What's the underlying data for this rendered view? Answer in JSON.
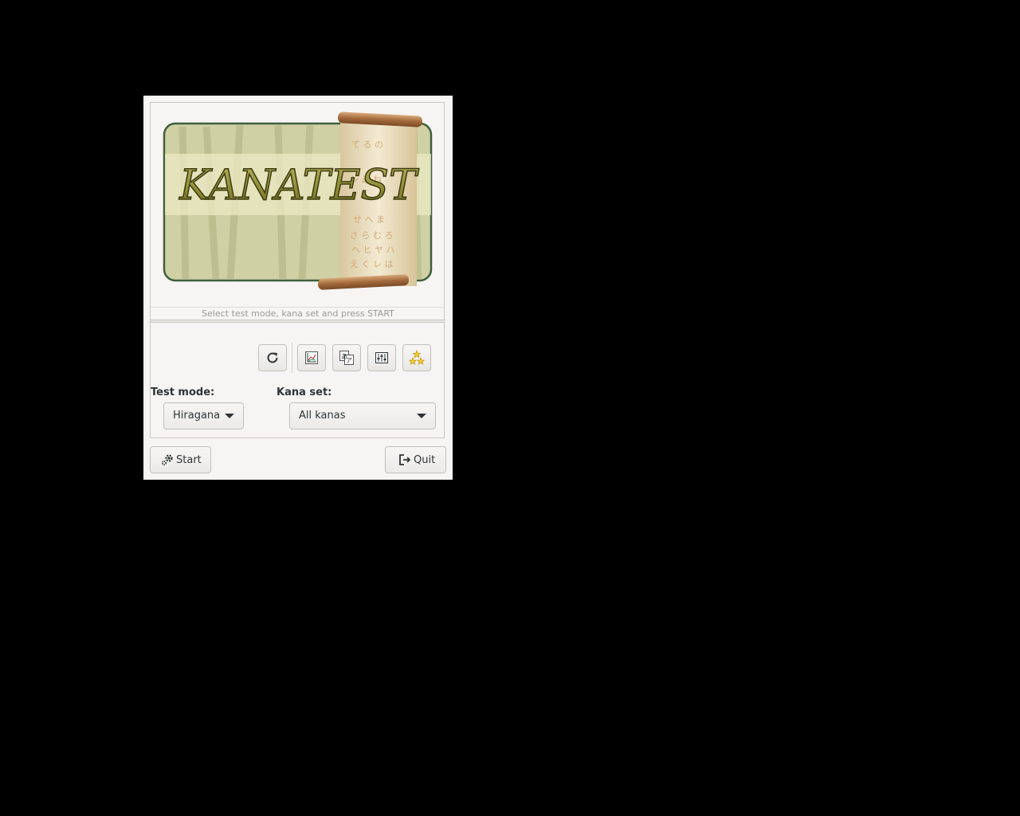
{
  "app": {
    "logo_text": "KANATEST"
  },
  "status_text": "Select test mode, kana set and press START",
  "toolbar": {
    "buttons": [
      {
        "icon": "refresh-icon"
      },
      {
        "icon": "statistics-icon"
      },
      {
        "icon": "kana-table-icon"
      },
      {
        "icon": "settings-icon"
      },
      {
        "icon": "about-stars-icon"
      }
    ]
  },
  "test_mode": {
    "label": "Test mode:",
    "value": "Hiragana"
  },
  "kana_set": {
    "label": "Kana set:",
    "value": "All kanas"
  },
  "actions": {
    "start_label": "Start",
    "quit_label": "Quit"
  },
  "colors": {
    "logo_bg": "#cfd0a4",
    "logo_border": "#3f5e3c",
    "logo_text": "#8c8a2c",
    "scroll": "#e8dcc0"
  }
}
